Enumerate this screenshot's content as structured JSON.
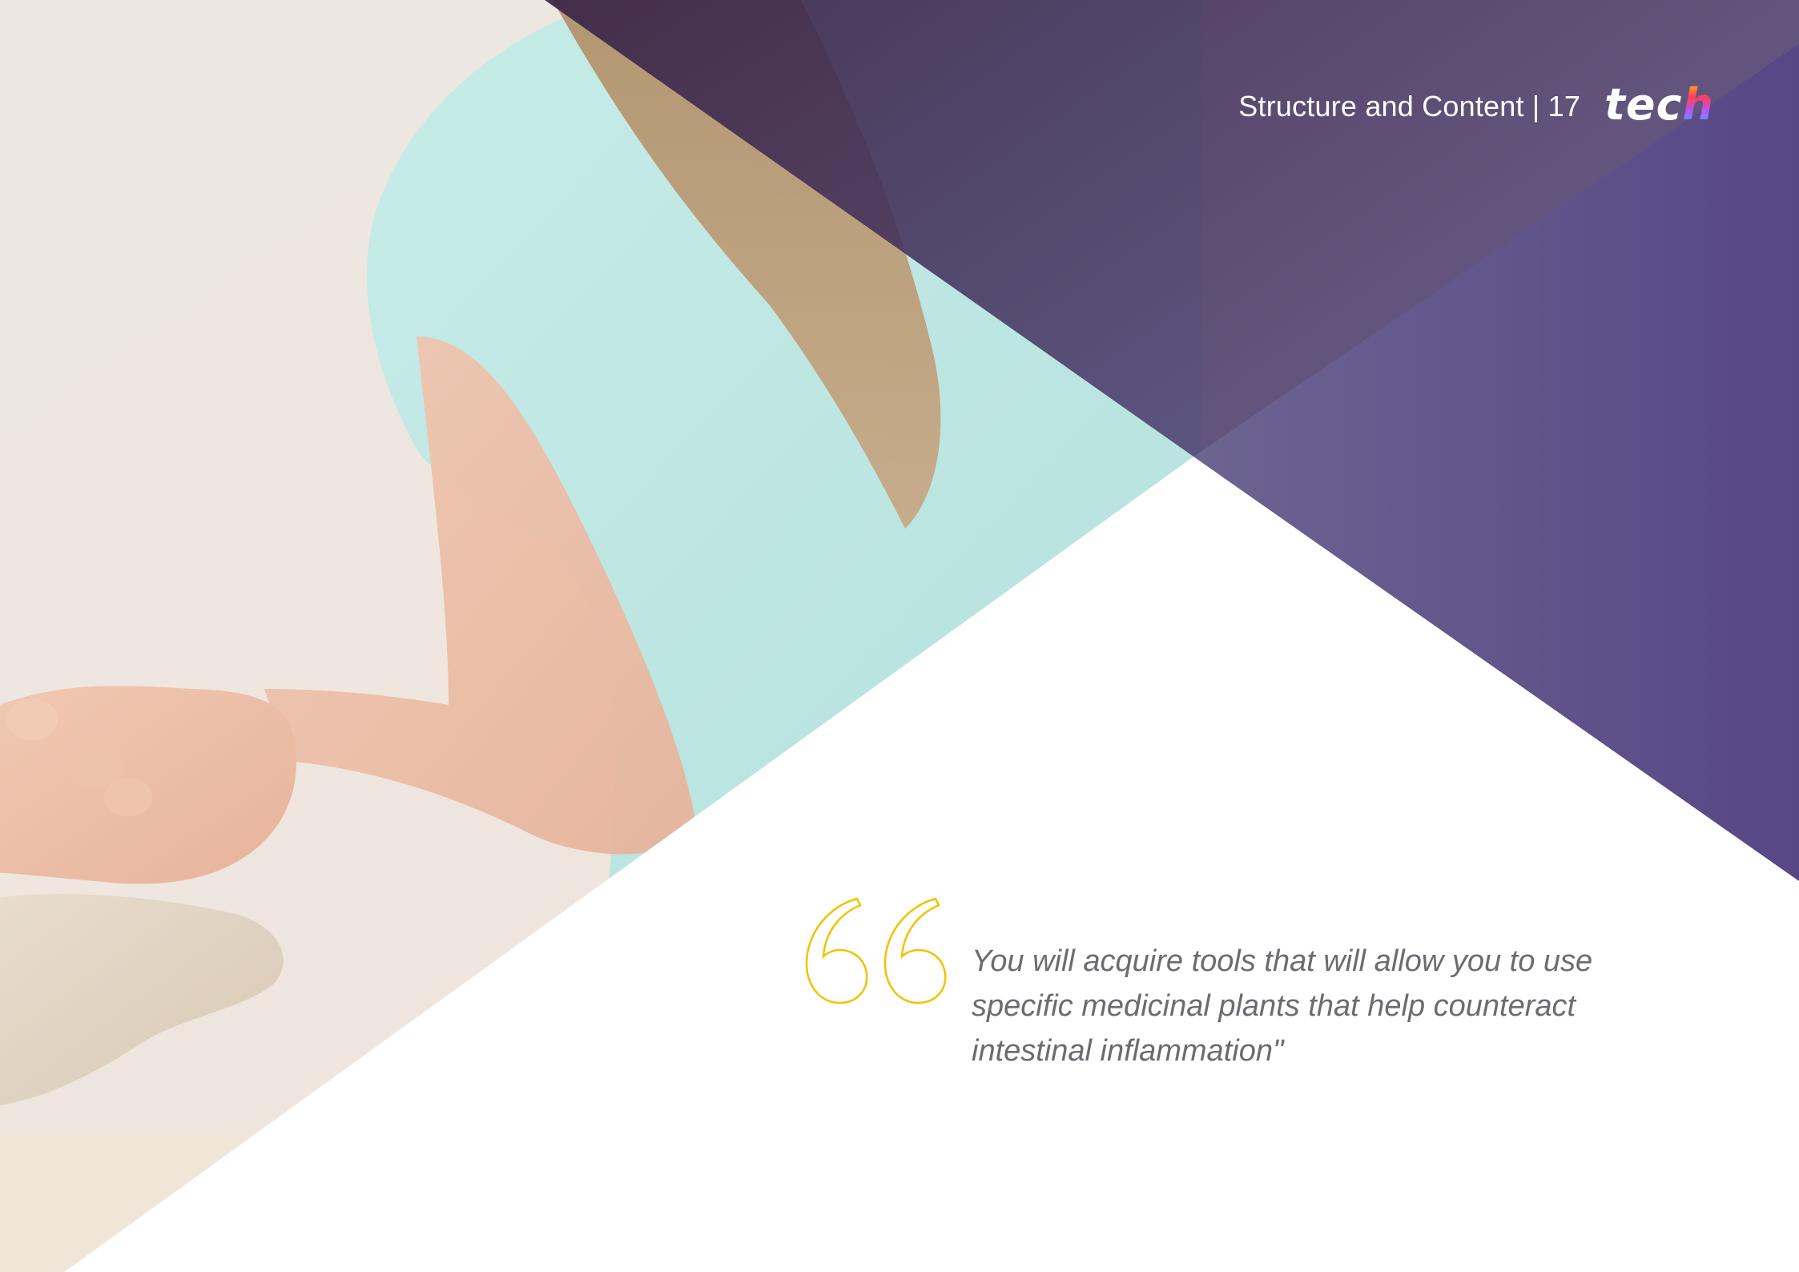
{
  "header": {
    "section_title": "Structure and Content | 17",
    "logo_text": "tec",
    "logo_accent": "h"
  },
  "quote": {
    "text": "You will acquire tools that will allow you to use specific medicinal plants that help counteract intestinal inflammation\"",
    "mark_color": "#f2c200"
  },
  "colors": {
    "purple_dark": "#3d2a4d",
    "purple": "#5b4a8a",
    "accent_yellow": "#f2c200",
    "text_gray": "#6b6b72"
  },
  "icons": [
    "open-quote-icon",
    "tech-logo"
  ]
}
